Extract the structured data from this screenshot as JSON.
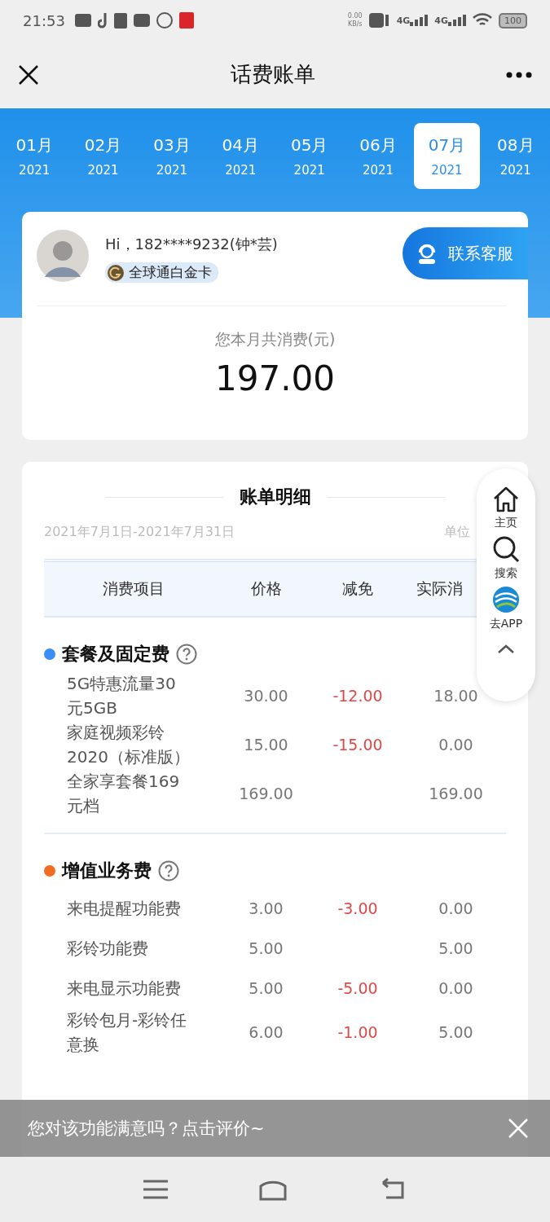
{
  "status_bar": {
    "time": "21:53",
    "net_speed": "0.00",
    "net_unit": "KB/s",
    "signal_labels": [
      "4G",
      "4G"
    ],
    "battery": "100"
  },
  "header": {
    "title": "话费账单"
  },
  "months": [
    {
      "month": "01月",
      "year": "2021",
      "selected": false
    },
    {
      "month": "02月",
      "year": "2021",
      "selected": false
    },
    {
      "month": "03月",
      "year": "2021",
      "selected": false
    },
    {
      "month": "04月",
      "year": "2021",
      "selected": false
    },
    {
      "month": "05月",
      "year": "2021",
      "selected": false
    },
    {
      "month": "06月",
      "year": "2021",
      "selected": false
    },
    {
      "month": "07月",
      "year": "2021",
      "selected": true
    },
    {
      "month": "08月",
      "year": "2021",
      "selected": false
    }
  ],
  "user": {
    "greeting": "Hi，182****9232(钟*芸)",
    "badge": "全球通白金卡",
    "contact_button": "联系客服"
  },
  "summary": {
    "label": "您本月共消费(元)",
    "amount": "197.00"
  },
  "detail": {
    "title": "账单明细",
    "period": "2021年7月1日-2021年7月31日",
    "unit": "单位",
    "columns": [
      "消费项目",
      "价格",
      "减免",
      "实际消"
    ],
    "sections": [
      {
        "name": "套餐及固定费",
        "color": "#3a8ef6",
        "rows": [
          {
            "item": "5G特惠流量30元5GB",
            "price": "30.00",
            "discount": "-12.00",
            "actual": "18.00"
          },
          {
            "item": "家庭视频彩铃2020（标准版）",
            "price": "15.00",
            "discount": "-15.00",
            "actual": "0.00"
          },
          {
            "item": "全家享套餐169元档",
            "price": "169.00",
            "actual": "169.00"
          }
        ]
      },
      {
        "name": "增值业务费",
        "color": "#f26b22",
        "rows": [
          {
            "item": "来电提醒功能费",
            "price": "3.00",
            "discount": "-3.00",
            "actual": "0.00"
          },
          {
            "item": "彩铃功能费",
            "price": "5.00",
            "actual": "5.00"
          },
          {
            "item": "来电显示功能费",
            "price": "5.00",
            "discount": "-5.00",
            "actual": "0.00"
          },
          {
            "item": "彩铃包月-彩铃任意换",
            "price": "6.00",
            "discount": "-1.00",
            "actual": "5.00"
          }
        ]
      }
    ]
  },
  "side_panel": [
    {
      "kind": "home",
      "label": "主页"
    },
    {
      "kind": "search",
      "label": "搜索"
    },
    {
      "kind": "app",
      "label": "去APP"
    },
    {
      "kind": "collapse"
    }
  ],
  "feedback_banner": {
    "text": "您对该功能满意吗？点击评价~"
  }
}
